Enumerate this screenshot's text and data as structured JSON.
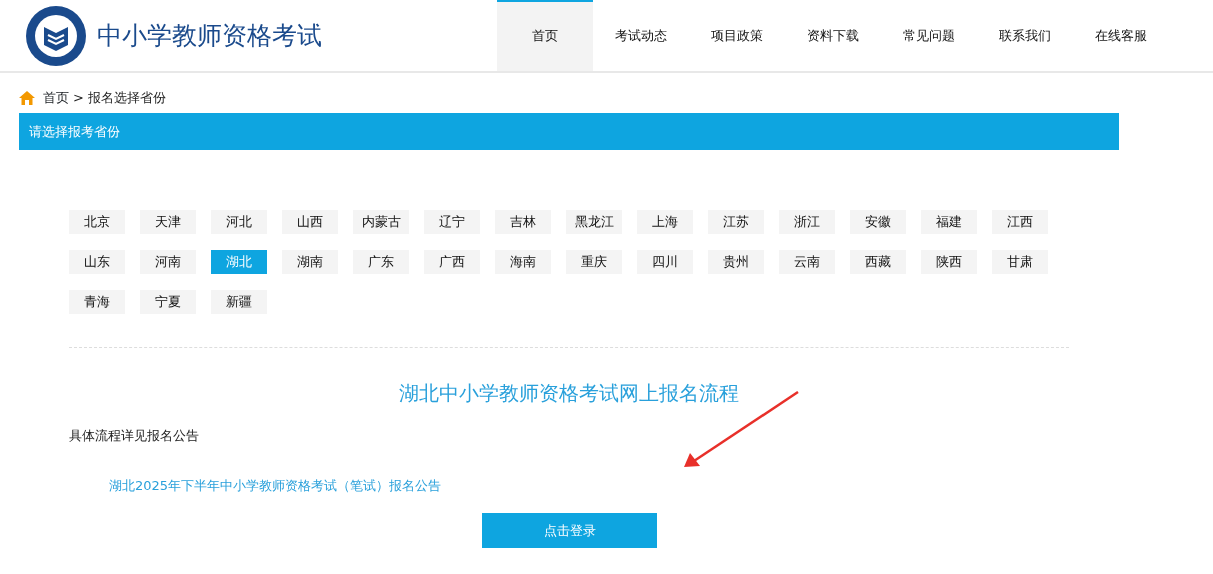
{
  "site": {
    "title": "中小学教师资格考试"
  },
  "nav": [
    {
      "label": "首页",
      "selected": true
    },
    {
      "label": "考试动态",
      "selected": false
    },
    {
      "label": "项目政策",
      "selected": false
    },
    {
      "label": "资料下载",
      "selected": false
    },
    {
      "label": "常见问题",
      "selected": false
    },
    {
      "label": "联系我们",
      "selected": false
    },
    {
      "label": "在线客服",
      "selected": false
    }
  ],
  "breadcrumb": {
    "home": "首页",
    "separator": ">",
    "current": "报名选择省份"
  },
  "section_title": "请选择报考省份",
  "provinces": [
    {
      "label": "北京",
      "selected": false
    },
    {
      "label": "天津",
      "selected": false
    },
    {
      "label": "河北",
      "selected": false
    },
    {
      "label": "山西",
      "selected": false
    },
    {
      "label": "内蒙古",
      "selected": false
    },
    {
      "label": "辽宁",
      "selected": false
    },
    {
      "label": "吉林",
      "selected": false
    },
    {
      "label": "黑龙江",
      "selected": false
    },
    {
      "label": "上海",
      "selected": false
    },
    {
      "label": "江苏",
      "selected": false
    },
    {
      "label": "浙江",
      "selected": false
    },
    {
      "label": "安徽",
      "selected": false
    },
    {
      "label": "福建",
      "selected": false
    },
    {
      "label": "江西",
      "selected": false
    },
    {
      "label": "山东",
      "selected": false
    },
    {
      "label": "河南",
      "selected": false
    },
    {
      "label": "湖北",
      "selected": true
    },
    {
      "label": "湖南",
      "selected": false
    },
    {
      "label": "广东",
      "selected": false
    },
    {
      "label": "广西",
      "selected": false
    },
    {
      "label": "海南",
      "selected": false
    },
    {
      "label": "重庆",
      "selected": false
    },
    {
      "label": "四川",
      "selected": false
    },
    {
      "label": "贵州",
      "selected": false
    },
    {
      "label": "云南",
      "selected": false
    },
    {
      "label": "西藏",
      "selected": false
    },
    {
      "label": "陕西",
      "selected": false
    },
    {
      "label": "甘肃",
      "selected": false
    },
    {
      "label": "青海",
      "selected": false
    },
    {
      "label": "宁夏",
      "selected": false
    },
    {
      "label": "新疆",
      "selected": false
    }
  ],
  "process": {
    "heading": "湖北中小学教师资格考试网上报名流程",
    "note": "具体流程详见报名公告",
    "link": "湖北2025年下半年中小学教师资格考试（笔试）报名公告",
    "button": "点击登录"
  }
}
